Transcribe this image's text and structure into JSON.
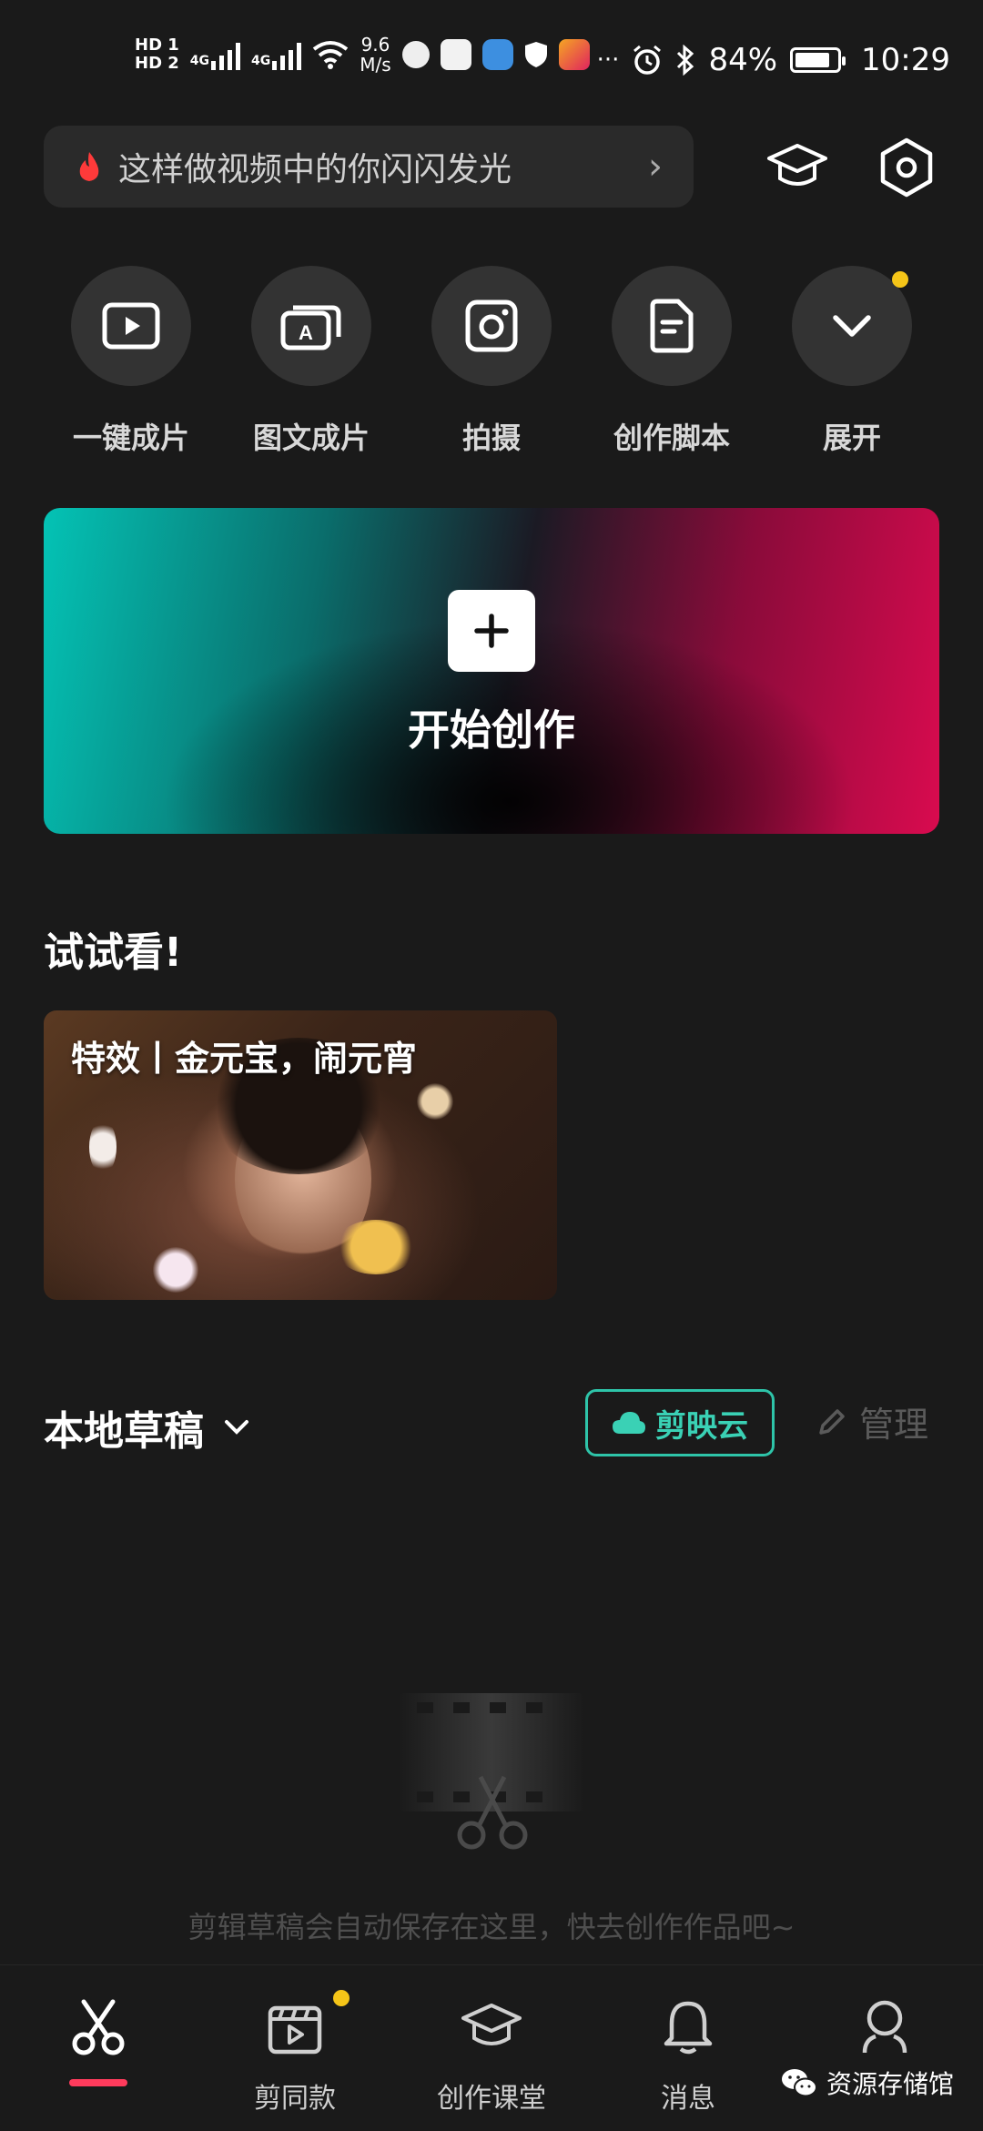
{
  "status_bar": {
    "hd1": "HD 1",
    "hd2": "HD 2",
    "net_type1": "4G",
    "net_type2": "4G",
    "speed_value": "9.6",
    "speed_unit": "M/s",
    "ellipsis": "···",
    "battery_percent": "84%",
    "battery_level": 0.84,
    "time": "10:29"
  },
  "header": {
    "search_text": "这样做视频中的你闪闪发光",
    "chevron": "›"
  },
  "quick_actions": [
    {
      "label": "一键成片",
      "icon": "play-box-icon"
    },
    {
      "label": "图文成片",
      "icon": "text-to-video-icon"
    },
    {
      "label": "拍摄",
      "icon": "camera-icon"
    },
    {
      "label": "创作脚本",
      "icon": "script-document-icon"
    },
    {
      "label": "展开",
      "icon": "chevron-down-icon"
    }
  ],
  "banner": {
    "title": "开始创作"
  },
  "try_section": {
    "title": "试试看!",
    "card_title": "特效丨金元宝，闹元宵"
  },
  "drafts": {
    "title": "本地草稿",
    "cloud_label": "剪映云",
    "manage_label": "管理",
    "empty_text": "剪辑草稿会自动保存在这里，快去创作作品吧~"
  },
  "bottom_nav": [
    {
      "label": "",
      "icon": "scissors-icon",
      "active": true
    },
    {
      "label": "剪同款",
      "icon": "clapper-play-icon"
    },
    {
      "label": "创作课堂",
      "icon": "graduation-cap-icon"
    },
    {
      "label": "消息",
      "icon": "bell-icon"
    },
    {
      "label": "",
      "icon": "user-icon"
    }
  ],
  "watermark": "资源存储馆",
  "colors": {
    "background": "#1a1a1a",
    "accent_teal": "#2ec4a9",
    "accent_red": "#ff3b5c",
    "notification_dot": "#f5c518"
  }
}
